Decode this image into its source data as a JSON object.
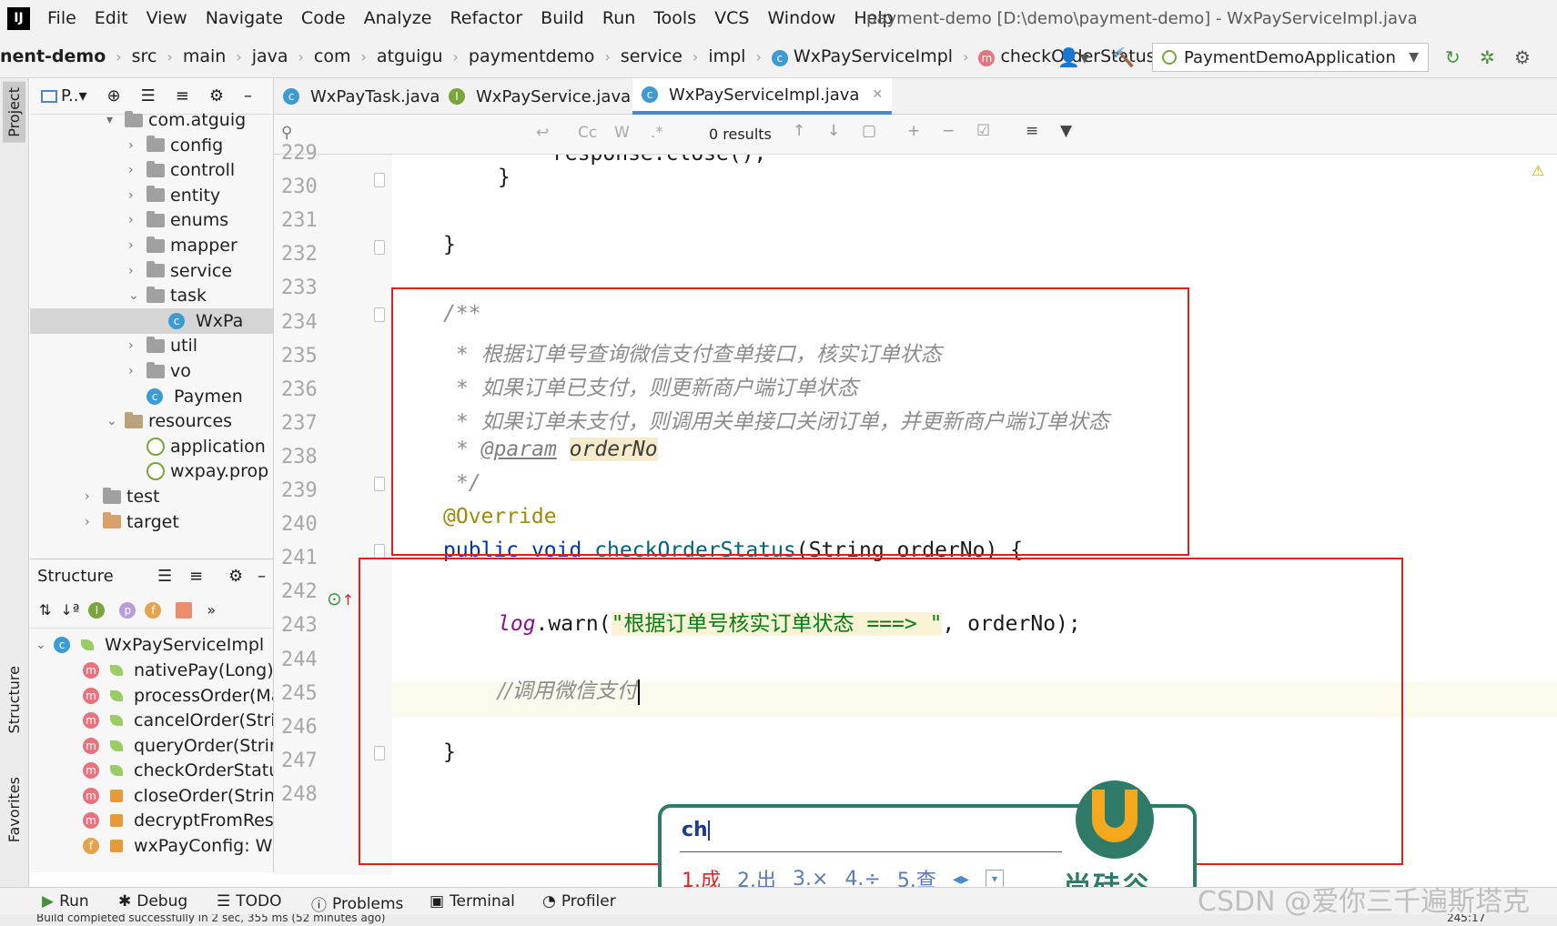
{
  "menubar": {
    "logo": "IJ",
    "items": [
      "File",
      "Edit",
      "View",
      "Navigate",
      "Code",
      "Analyze",
      "Refactor",
      "Build",
      "Run",
      "Tools",
      "VCS",
      "Window",
      "Help"
    ],
    "title": "payment-demo [D:\\demo\\payment-demo] - WxPayServiceImpl.java"
  },
  "navbar": {
    "crumbs": [
      "nent-demo",
      "src",
      "main",
      "java",
      "com",
      "atguigu",
      "paymentdemo",
      "service",
      "impl"
    ],
    "class_crumb": "WxPayServiceImpl",
    "method_crumb": "checkOrderStatus",
    "run_config": "PaymentDemoApplication"
  },
  "left_stripe": {
    "project": "Project",
    "structure": "Structure",
    "favorites": "Favorites"
  },
  "project": {
    "header_label": "P..▾",
    "tree": [
      {
        "label": "com.atguig",
        "kind": "pkg",
        "indent": 0,
        "arrow": "▾"
      },
      {
        "label": "config",
        "kind": "folder",
        "indent": 1,
        "arrow": "›"
      },
      {
        "label": "controll",
        "kind": "folder",
        "indent": 1,
        "arrow": "›"
      },
      {
        "label": "entity",
        "kind": "folder",
        "indent": 1,
        "arrow": "›"
      },
      {
        "label": "enums",
        "kind": "folder",
        "indent": 1,
        "arrow": "›"
      },
      {
        "label": "mapper",
        "kind": "folder",
        "indent": 1,
        "arrow": "›"
      },
      {
        "label": "service",
        "kind": "folder",
        "indent": 1,
        "arrow": "›"
      },
      {
        "label": "task",
        "kind": "folder",
        "indent": 1,
        "arrow": "⌄"
      },
      {
        "label": "WxPa",
        "kind": "class",
        "indent": 2,
        "arrow": ""
      },
      {
        "label": "util",
        "kind": "folder",
        "indent": 1,
        "arrow": "›"
      },
      {
        "label": "vo",
        "kind": "folder",
        "indent": 1,
        "arrow": "›"
      },
      {
        "label": "Paymen",
        "kind": "app",
        "indent": 1,
        "arrow": ""
      },
      {
        "label": "resources",
        "kind": "res",
        "indent": 0,
        "arrow": "⌄"
      },
      {
        "label": "application",
        "kind": "settings",
        "indent": 1,
        "arrow": ""
      },
      {
        "label": "wxpay.prop",
        "kind": "settings",
        "indent": 1,
        "arrow": ""
      },
      {
        "label": "test",
        "kind": "folder",
        "indent": -1,
        "arrow": "›"
      },
      {
        "label": "target",
        "kind": "target",
        "indent": -1,
        "arrow": "›"
      }
    ]
  },
  "structure": {
    "title": "Structure",
    "class_name": "WxPayServiceImpl",
    "members": [
      {
        "label": "nativePay(Long): M",
        "kind": "m",
        "access": "public"
      },
      {
        "label": "processOrder(Ma",
        "kind": "m",
        "access": "public"
      },
      {
        "label": "cancelOrder(Strin",
        "kind": "m",
        "access": "public"
      },
      {
        "label": "queryOrder(String",
        "kind": "m",
        "access": "public"
      },
      {
        "label": "checkOrderStatus",
        "kind": "m",
        "access": "public"
      },
      {
        "label": "closeOrder(String",
        "kind": "m",
        "access": "private"
      },
      {
        "label": "decryptFromReso",
        "kind": "m",
        "access": "private"
      },
      {
        "label": "wxPayConfig: WxP",
        "kind": "f",
        "access": "private"
      }
    ]
  },
  "tabs": [
    {
      "label": "WxPayTask.java",
      "icon": "c"
    },
    {
      "label": "WxPayService.java",
      "icon": "i"
    },
    {
      "label": "WxPayServiceImpl.java",
      "icon": "c",
      "active": true
    }
  ],
  "findbar": {
    "results": "0 results",
    "case_label": "Cc",
    "word_label": "W",
    "regex_label": ".*"
  },
  "editor": {
    "line_numbers": [
      "229",
      "230",
      "231",
      "232",
      "233",
      "234",
      "235",
      "236",
      "237",
      "238",
      "239",
      "240",
      "241",
      "242",
      "243",
      "244",
      "245",
      "246",
      "247",
      "248"
    ],
    "lines": {
      "l229": "response.close();",
      "l230": "}",
      "l232": "}",
      "l234": "/**",
      "l235_star": "*",
      "l235": "根据订单号查询微信支付查单接口，核实订单状态",
      "l236_star": "*",
      "l236": "如果订单已支付，则更新商户端订单状态",
      "l237_star": "*",
      "l237": "如果订单未支付，则调用关单接口关闭订单，并更新商户端订单状态",
      "l238_star": "*",
      "l238_tag": "@param",
      "l238_param": "orderNo",
      "l239": "*/",
      "l240": "@Override",
      "l241_kw1": "public",
      "l241_kw2": "void",
      "l241_fn": "checkOrderStatus",
      "l241_rest": "(String orderNo) {",
      "l243_log": "log",
      "l243_warn": ".warn(",
      "l243_str": "\"根据订单号核实订单状态 ===> \"",
      "l243_rest": ", orderNo);",
      "l245": "//调用微信支付",
      "l247": "}"
    }
  },
  "ime": {
    "input": "ch",
    "candidates": [
      "1.成",
      "2.出",
      "3.×",
      "4.÷",
      "5.查"
    ],
    "brand": "尚硅谷"
  },
  "bottombar": {
    "run": "Run",
    "debug": "Debug",
    "todo": "TODO",
    "problems": "Problems",
    "terminal": "Terminal",
    "profiler": "Profiler"
  },
  "status": {
    "message": "Build completed successfully in 2 sec, 355 ms (52 minutes ago)",
    "position": "245:17"
  },
  "watermark": "CSDN @爱你三千遍斯塔克",
  "colors": {
    "accent": "#4a88c7",
    "red_box": "#e02020",
    "ime_green": "#2f7a68",
    "ime_orange": "#f4a81d"
  }
}
